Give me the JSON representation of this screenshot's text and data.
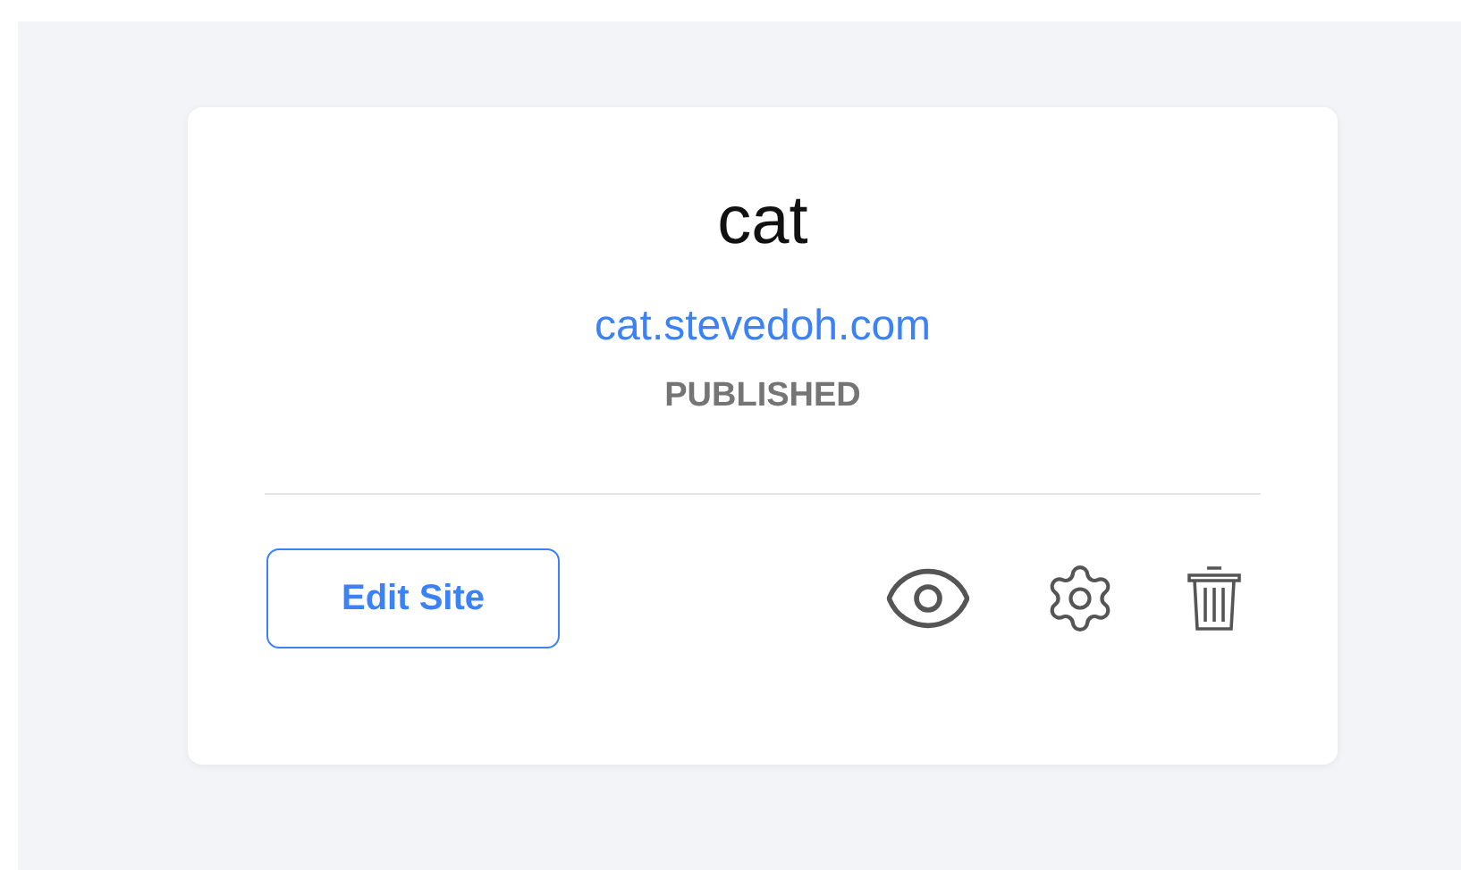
{
  "site": {
    "name": "cat",
    "url": "cat.stevedoh.com",
    "status": "PUBLISHED"
  },
  "actions": {
    "edit_button": "Edit Site"
  }
}
